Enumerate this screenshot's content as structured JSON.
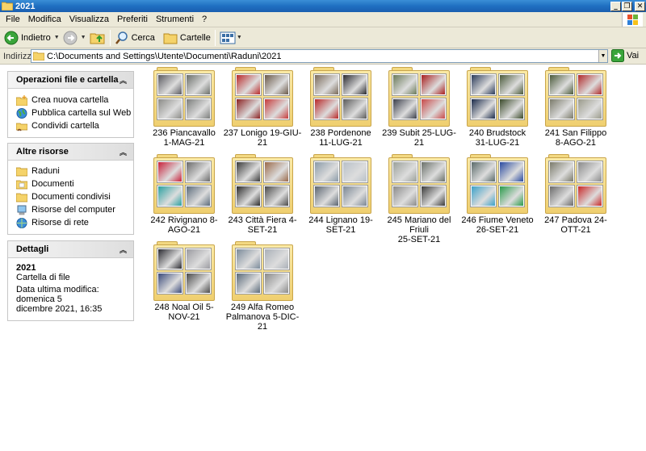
{
  "window": {
    "title": "2021"
  },
  "menu": [
    "File",
    "Modifica",
    "Visualizza",
    "Preferiti",
    "Strumenti",
    "?"
  ],
  "toolbar": {
    "back": "Indietro",
    "search": "Cerca",
    "folders": "Cartelle"
  },
  "address": {
    "label": "Indirizzo",
    "path": "C:\\Documents and Settings\\Utente\\Documenti\\Raduni\\2021",
    "go": "Vai"
  },
  "tasks": {
    "title": "Operazioni file e cartella",
    "items": [
      "Crea nuova cartella",
      "Pubblica cartella sul Web",
      "Condividi cartella"
    ]
  },
  "other": {
    "title": "Altre risorse",
    "items": [
      "Raduni",
      "Documenti",
      "Documenti condivisi",
      "Risorse del computer",
      "Risorse di rete"
    ]
  },
  "details": {
    "title": "Dettagli",
    "name": "2021",
    "type": "Cartella di file",
    "modified1": "Data ultima modifica: domenica 5",
    "modified2": "dicembre 2021, 16:35"
  },
  "folders": [
    {
      "l1": "236 Piancavallo",
      "l2": "1-MAG-21"
    },
    {
      "l1": "237 Lonigo 19-GIU-21",
      "l2": ""
    },
    {
      "l1": "238 Pordenone",
      "l2": "11-LUG-21"
    },
    {
      "l1": "239 Subit 25-LUG-21",
      "l2": ""
    },
    {
      "l1": "240 Brudstock",
      "l2": "31-LUG-21"
    },
    {
      "l1": "241 San Filippo",
      "l2": "8-AGO-21"
    },
    {
      "l1": "242 Rivignano 8-AGO-21",
      "l2": ""
    },
    {
      "l1": "243 Città Fiera 4-SET-21",
      "l2": ""
    },
    {
      "l1": "244 Lignano 19-SET-21",
      "l2": ""
    },
    {
      "l1": "245 Mariano del Friuli",
      "l2": "25-SET-21"
    },
    {
      "l1": "246 Fiume Veneto",
      "l2": "26-SET-21"
    },
    {
      "l1": "247 Padova 24-OTT-21",
      "l2": ""
    },
    {
      "l1": "248 Noal Oil 5-NOV-21",
      "l2": ""
    },
    {
      "l1": "249 Alfa Romeo",
      "l2": "Palmanova 5-DIC-21"
    }
  ]
}
